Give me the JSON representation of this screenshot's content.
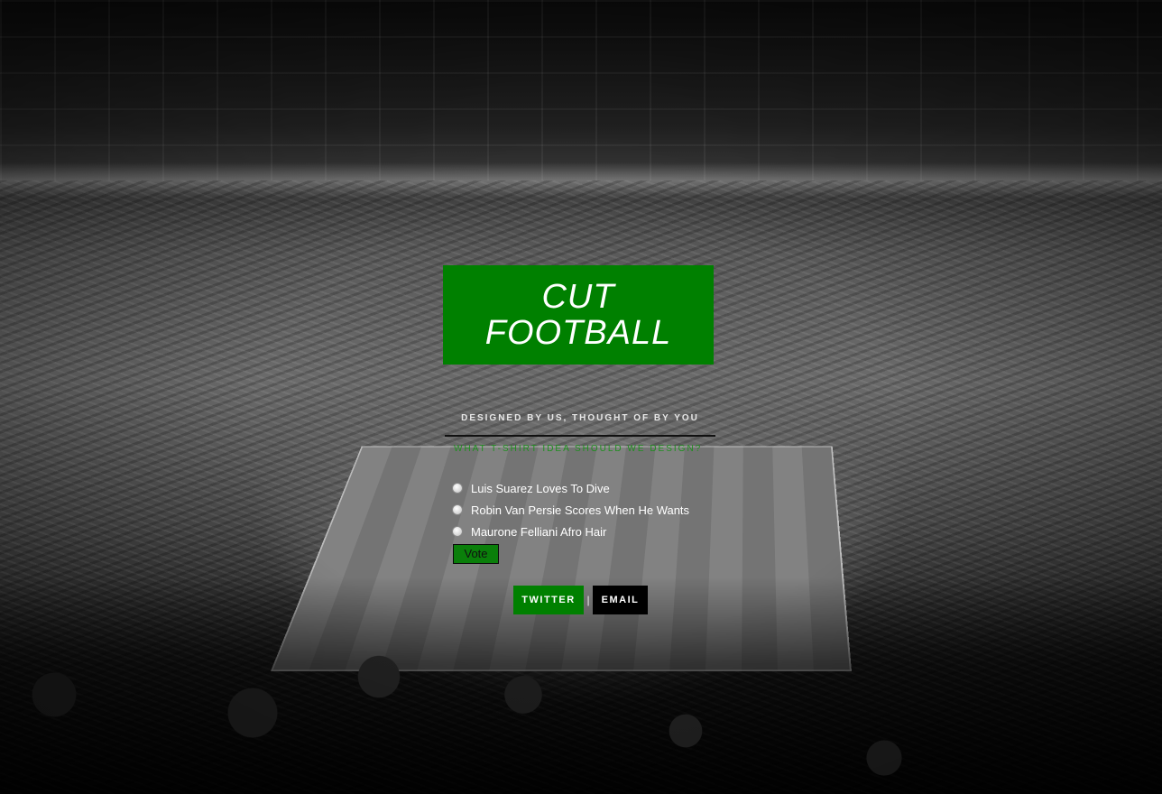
{
  "brand": {
    "line1": "CUT",
    "line2": "FOOTBALL",
    "accent_color": "#008000"
  },
  "tagline": "DESIGNED BY US, THOUGHT OF BY YOU",
  "poll": {
    "question": "WHAT T-SHIRT IDEA SHOULD WE DESIGN?",
    "options": [
      "Luis Suarez Loves To Dive",
      "Robin Van Persie Scores When He Wants",
      "Maurone Felliani Afro Hair"
    ],
    "vote_label": "Vote"
  },
  "share": {
    "twitter_label": "TWITTER",
    "separator": "|",
    "email_label": "EMAIL"
  },
  "background": {
    "scene": "grayscale-football-stadium"
  }
}
